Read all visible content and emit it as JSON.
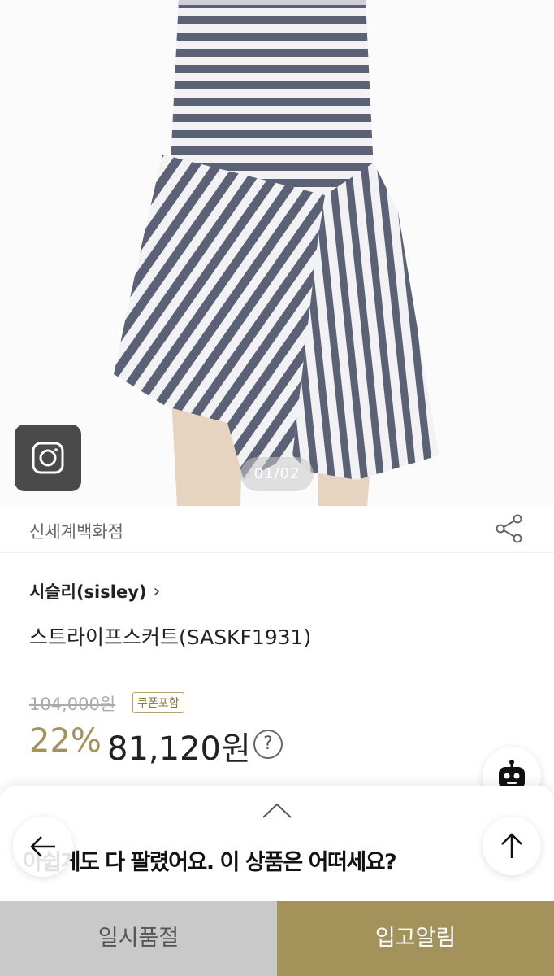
{
  "product_image": {
    "pager": "01/02",
    "insta_icon": "camera-icon"
  },
  "seller": {
    "name": "신세계백화점",
    "share_icon": "share-icon"
  },
  "brand": {
    "name": "시슬리(sisley)",
    "chevron": "›"
  },
  "product": {
    "name": "스트라이프스커트(SASKF1931)"
  },
  "price": {
    "original": "104,000원",
    "coupon_badge": "쿠폰포함",
    "discount": "22%",
    "sale": "81,120원",
    "help_icon": "?"
  },
  "sheet": {
    "message": "아쉽게도 다 팔렸어요. 이 상품은 어떠세요?"
  },
  "actions": {
    "soldout_label": "일시품절",
    "notify_label": "입고알림"
  },
  "colors": {
    "accent": "#a3925a",
    "disabled": "#c9c9c9",
    "stripe": "#5c6275"
  }
}
